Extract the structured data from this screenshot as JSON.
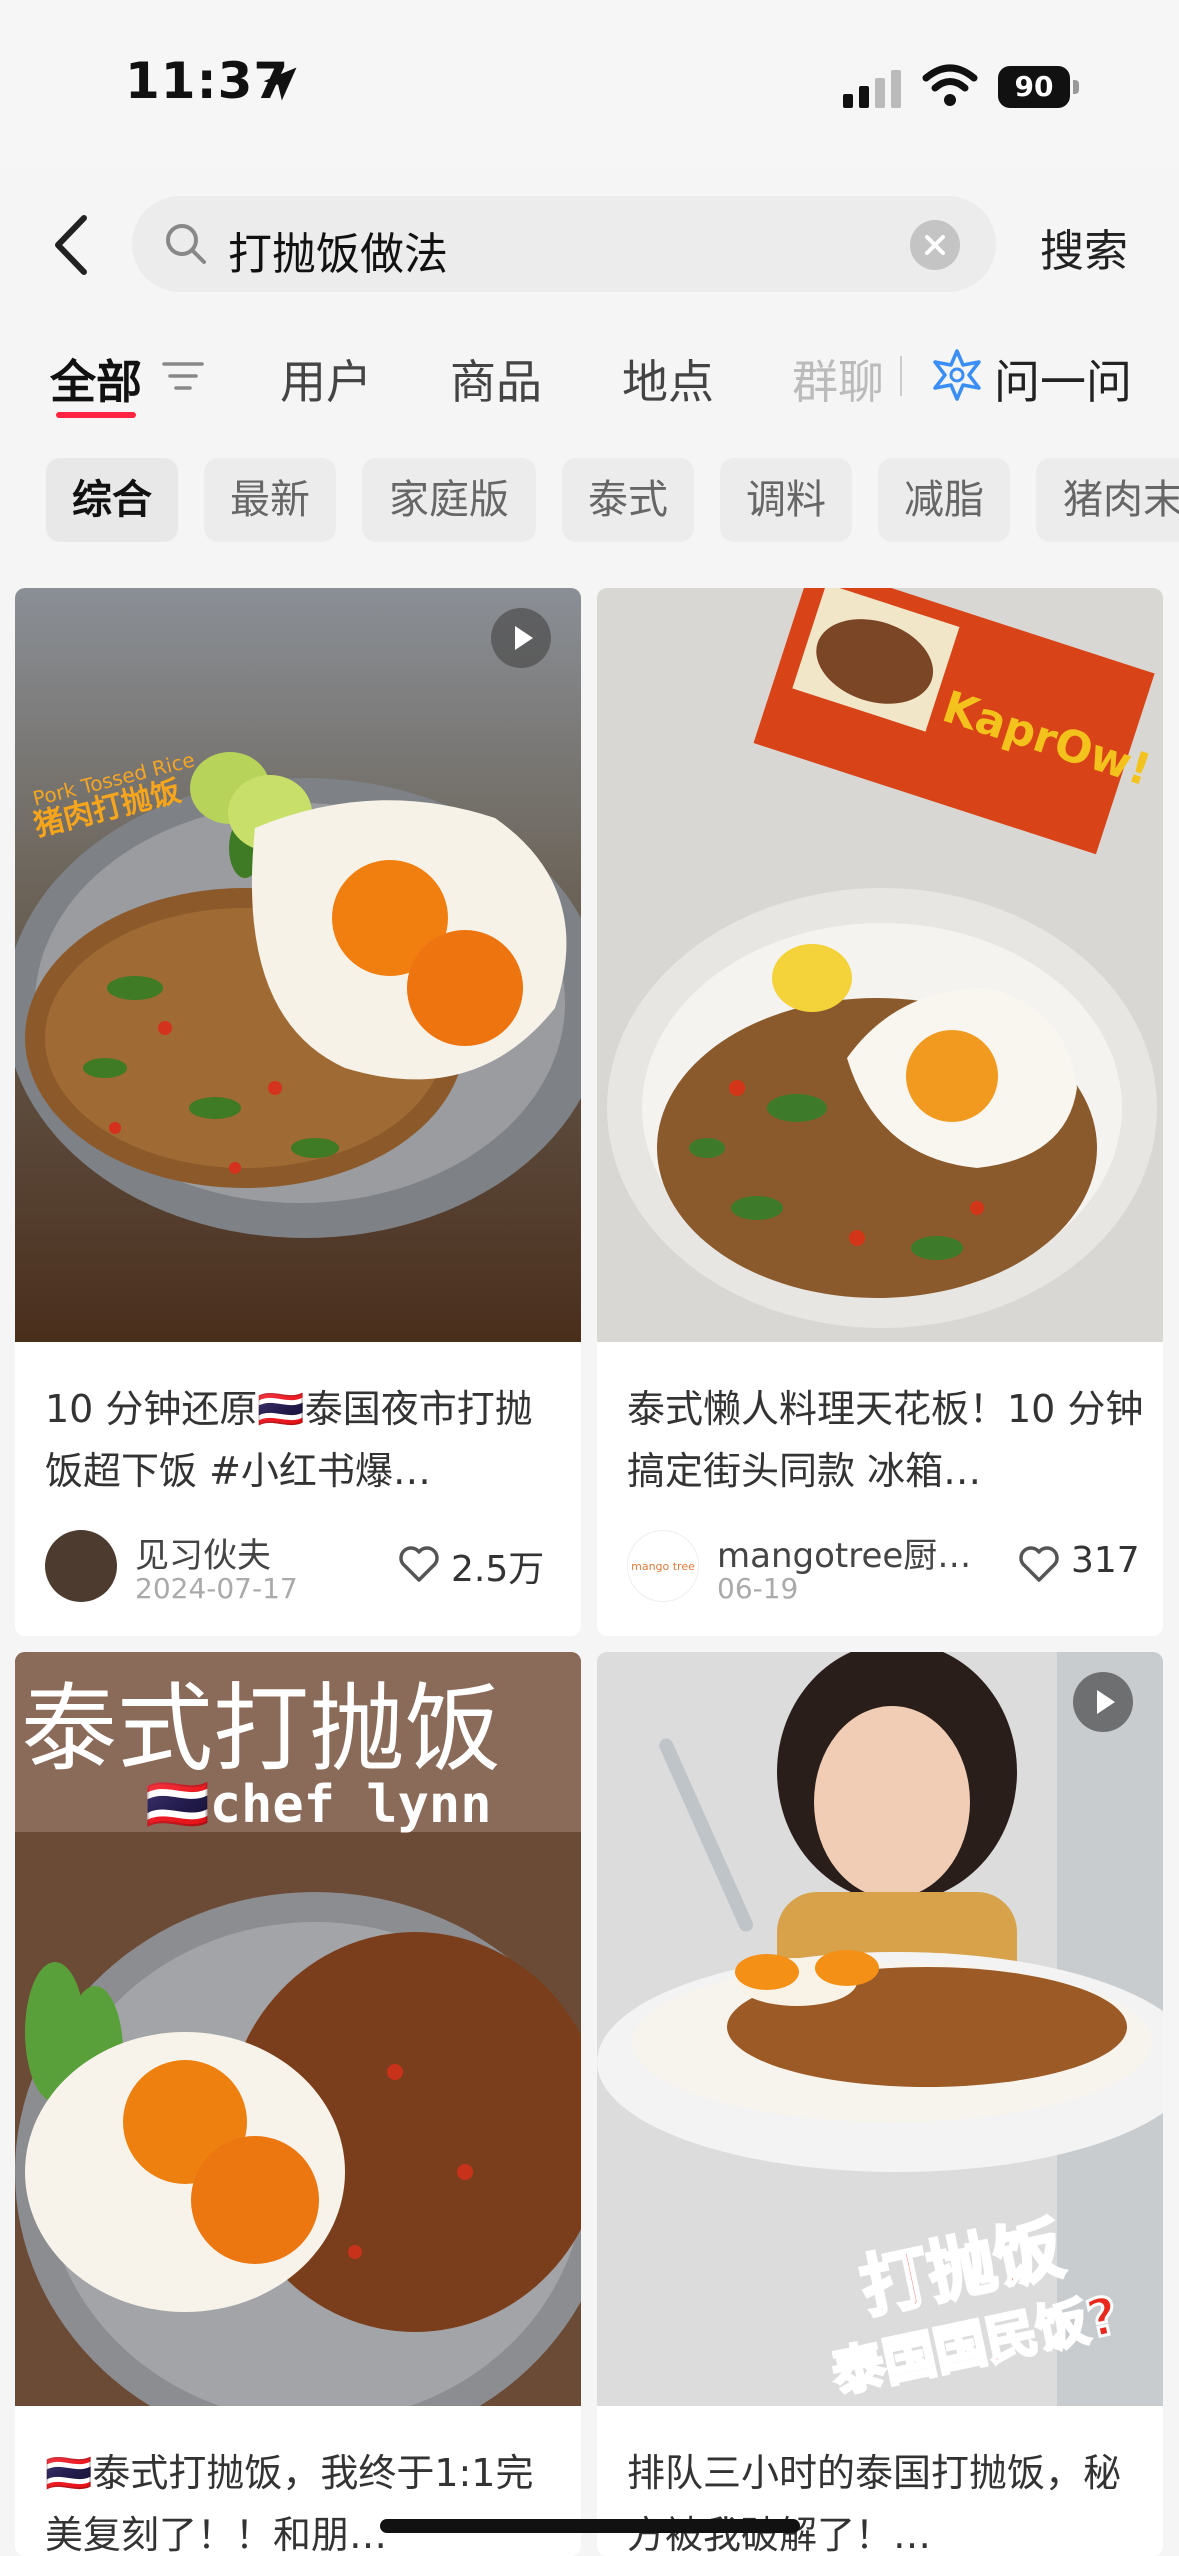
{
  "status": {
    "time": "11:37",
    "battery": "90"
  },
  "search": {
    "query": "打抛饭做法",
    "button": "搜索"
  },
  "tabs": {
    "all": "全部",
    "users": "用户",
    "products": "商品",
    "places": "地点",
    "groups": "群聊",
    "ask": "问一问"
  },
  "chips": [
    "综合",
    "最新",
    "家庭版",
    "泰式",
    "调料",
    "减脂",
    "猪肉末"
  ],
  "cards": [
    {
      "title": "10 分钟还原🇹🇭泰国夜市打抛饭超下饭 #小红书爆…",
      "author": "见习伙夫",
      "date": "2024-07-17",
      "likes": "2.5万",
      "image_text": [
        "Pork Tossed Rice",
        "猪肉打抛饭"
      ]
    },
    {
      "title": "泰式懒人料理天花板！10 分钟搞定街头同款 冰箱…",
      "author": "mangotree厨…",
      "date": "06-19",
      "likes": "317",
      "image_text": [
        "KaprOw!",
        "mango tree"
      ]
    },
    {
      "title": "🇹🇭泰式打抛饭，我终于1:1完美复刻了！！和朋…",
      "image_text": [
        "泰式打抛饭",
        "🇹🇭chef lynn"
      ]
    },
    {
      "title": "排队三小时的泰国打抛饭，秘方被我破解了！…",
      "image_text": [
        "打抛饭",
        "泰国国民饭?"
      ]
    }
  ],
  "colors": {
    "accent": "#ff2442",
    "ask_blue": "#3a8ef6"
  }
}
